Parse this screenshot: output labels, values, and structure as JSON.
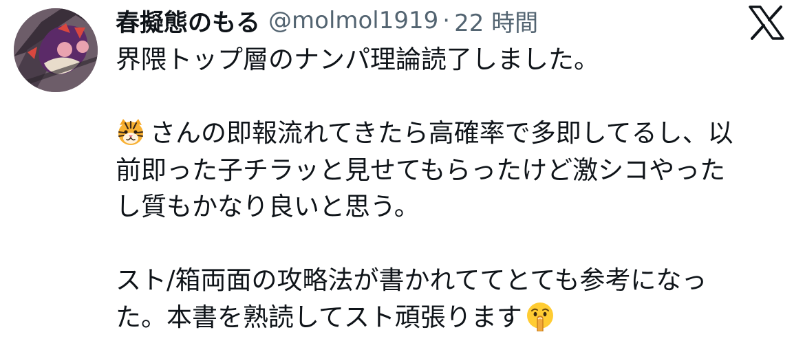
{
  "author": {
    "display_name": "春擬態のもる",
    "handle": "@molmol1919",
    "separator": "·",
    "timestamp": "22 時間"
  },
  "platform_icon": "x-logo-icon",
  "tweet": {
    "lines": [
      "界隈トップ層のナンパ理論読了しました。",
      "",
      "さんの即報流れてきたら高確率で多即してるし、以",
      "前即った子チラッと見せてもらったけど激シコやった",
      "し質もかなり良いと思う。",
      "",
      "スト/箱両面の攻略法が書かれててとても参考になっ",
      "た。本書を熟読してスト頑張ります"
    ],
    "emojis": {
      "line3_prefix": "tiger-face-emoji",
      "line8_suffix": "shushing-face-emoji"
    }
  },
  "colors": {
    "text_primary": "#0f1419",
    "text_secondary": "#536471",
    "background": "#ffffff"
  }
}
